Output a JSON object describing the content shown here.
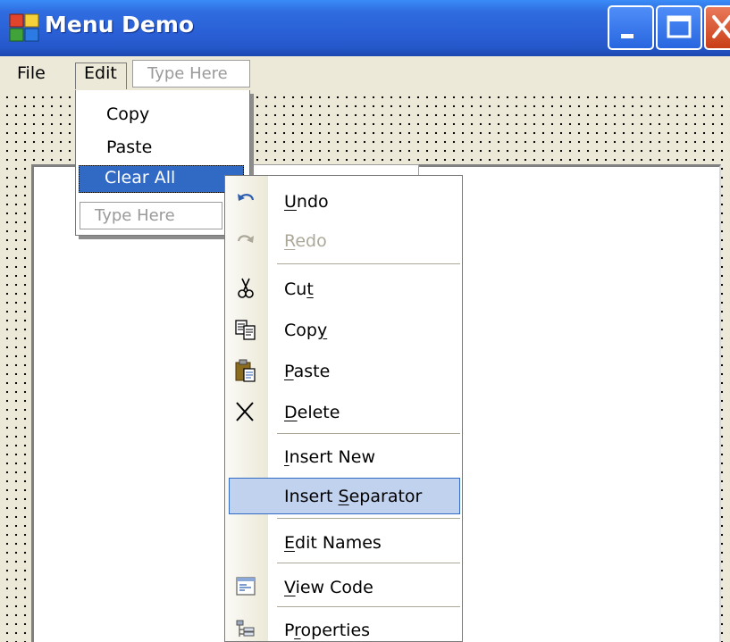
{
  "window": {
    "title": "Menu Demo",
    "titlebar_color": "#2a5fd6",
    "buttons": [
      {
        "name": "minimize-icon"
      },
      {
        "name": "maximize-icon"
      },
      {
        "name": "close-icon"
      }
    ]
  },
  "menubar": {
    "items": [
      "File",
      "Edit"
    ],
    "type_here": "Type Here"
  },
  "edit_menu": {
    "items": [
      "Copy",
      "Paste",
      "Clear All"
    ],
    "selected": "Clear All",
    "selected_color": "#316ac5",
    "type_here": "Type Here"
  },
  "context_menu": {
    "highlight_color": "#c1d2ee",
    "items": [
      {
        "label_pre": "",
        "label_key": "U",
        "label_post": "ndo",
        "icon": "undo-icon",
        "enabled": true
      },
      {
        "label_pre": "",
        "label_key": "R",
        "label_post": "edo",
        "icon": "redo-icon",
        "enabled": false
      },
      {
        "label_pre": "Cu",
        "label_key": "t",
        "label_post": "",
        "icon": "scissors-icon",
        "enabled": true
      },
      {
        "label_pre": "Cop",
        "label_key": "y",
        "label_post": "",
        "icon": "copy-icon",
        "enabled": true
      },
      {
        "label_pre": "",
        "label_key": "P",
        "label_post": "aste",
        "icon": "clipboard-icon",
        "enabled": true
      },
      {
        "label_pre": "",
        "label_key": "D",
        "label_post": "elete",
        "icon": "delete-x-icon",
        "enabled": true
      },
      {
        "label_pre": "",
        "label_key": "I",
        "label_post": "nsert New",
        "icon": "",
        "enabled": true
      },
      {
        "label_pre": "Insert ",
        "label_key": "S",
        "label_post": "eparator",
        "icon": "",
        "enabled": true,
        "highlighted": true
      },
      {
        "label_pre": "",
        "label_key": "E",
        "label_post": "dit Names",
        "icon": "",
        "enabled": true
      },
      {
        "label_pre": "",
        "label_key": "V",
        "label_post": "iew Code",
        "icon": "view-code-icon",
        "enabled": true
      },
      {
        "label_pre": "P",
        "label_key": "r",
        "label_post": "operties",
        "icon": "properties-icon",
        "enabled": true
      }
    ]
  }
}
